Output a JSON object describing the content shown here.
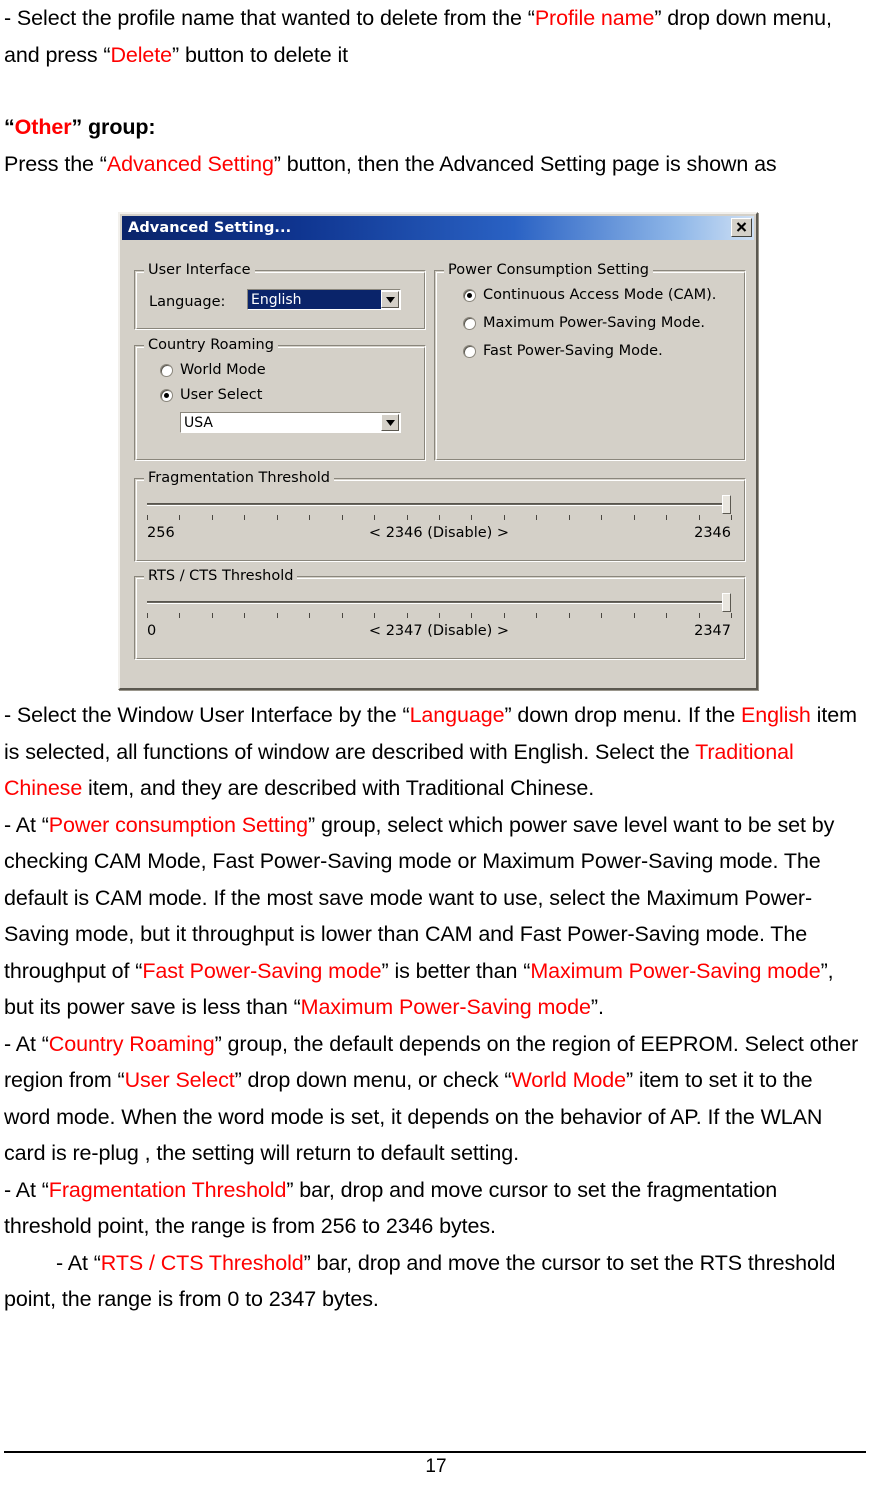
{
  "document": {
    "page_number": "17",
    "paragraphs": [
      {
        "id": "p1",
        "runs": [
          {
            "t": "-    Select the profile name that wanted to delete from the “",
            "c": "black"
          },
          {
            "t": "Profile name",
            "c": "red"
          },
          {
            "t": "” drop down menu, and press “",
            "c": "black"
          },
          {
            "t": "Delete",
            "c": "red"
          },
          {
            "t": "” button to delete it",
            "c": "black"
          }
        ]
      },
      {
        "id": "p2",
        "bold": true,
        "runs": [
          {
            "t": "“",
            "c": "black"
          },
          {
            "t": "Other",
            "c": "red"
          },
          {
            "t": "” group:",
            "c": "black"
          }
        ]
      },
      {
        "id": "p3",
        "runs": [
          {
            "t": "Press the “",
            "c": "black"
          },
          {
            "t": "Advanced Setting",
            "c": "red"
          },
          {
            "t": "” button, then the Advanced Setting page is shown as",
            "c": "black"
          }
        ]
      },
      {
        "id": "p4",
        "runs": [
          {
            "t": "-   Select the Window User Interface by the “",
            "c": "black"
          },
          {
            "t": "Language",
            "c": "red"
          },
          {
            "t": "” down drop menu. If the ",
            "c": "black"
          },
          {
            "t": "English",
            "c": "red"
          },
          {
            "t": " item is selected, all functions of window are described with English. Select the ",
            "c": "black"
          },
          {
            "t": "Traditional Chinese",
            "c": "red"
          },
          {
            "t": " item, and they are described with Traditional Chinese.",
            "c": "black"
          }
        ]
      },
      {
        "id": "p5",
        "runs": [
          {
            "t": "-   At “",
            "c": "black"
          },
          {
            "t": "Power consumption Setting",
            "c": "red"
          },
          {
            "t": "” group, select which power save level want to be set by checking CAM Mode, Fast Power-Saving mode or Maximum Power-Saving mode. The default is CAM mode. If the most save mode want to use, select the Maximum Power-Saving mode, but it throughput is lower than CAM and Fast Power-Saving mode. The throughput of   “",
            "c": "black"
          },
          {
            "t": "Fast Power-Saving mode",
            "c": "red"
          },
          {
            "t": "” is better than “",
            "c": "black"
          },
          {
            "t": "Maximum Power-Saving mode",
            "c": "red"
          },
          {
            "t": "”, but its power save is less than “",
            "c": "black"
          },
          {
            "t": "Maximum Power-Saving mode",
            "c": "red"
          },
          {
            "t": "”.",
            "c": "black"
          }
        ]
      },
      {
        "id": "p6",
        "runs": [
          {
            "t": "-   At “",
            "c": "black"
          },
          {
            "t": "Country Roaming",
            "c": "red"
          },
          {
            "t": "” group, the default depends on the region of EEPROM. Select other region from “",
            "c": "black"
          },
          {
            "t": "User Select",
            "c": "red"
          },
          {
            "t": "” drop down menu, or check “",
            "c": "black"
          },
          {
            "t": "World Mode",
            "c": "red"
          },
          {
            "t": "” item to set it to the word mode. When the word mode is set, it depends on the behavior of AP. If the WLAN card is re-plug , the setting will return to default setting.",
            "c": "black"
          }
        ]
      },
      {
        "id": "p7",
        "runs": [
          {
            "t": "-   At “",
            "c": "black"
          },
          {
            "t": "Fragmentation Threshold",
            "c": "red"
          },
          {
            "t": "” bar, drop and move cursor to set the fragmentation threshold point, the range is from 256 to 2346 bytes.",
            "c": "black"
          }
        ]
      },
      {
        "id": "p8",
        "indent": true,
        "runs": [
          {
            "t": "-   At “",
            "c": "black"
          },
          {
            "t": "RTS / CTS Threshold",
            "c": "red"
          },
          {
            "t": "” bar, drop and move the cursor to set the RTS threshold point, the range is from 0 to 2347 bytes.",
            "c": "black"
          }
        ]
      }
    ]
  },
  "dialog": {
    "title": "Advanced Setting...",
    "close_label": "×",
    "user_interface": {
      "legend": "User Interface",
      "language_label": "Language:",
      "language_value": "English"
    },
    "country_roaming": {
      "legend": "Country Roaming",
      "options": [
        {
          "label": "World Mode",
          "checked": false
        },
        {
          "label": "User Select",
          "checked": true
        }
      ],
      "region_value": "USA"
    },
    "power_consumption": {
      "legend": "Power Consumption Setting",
      "options": [
        {
          "label": "Continuous Access Mode (CAM).",
          "checked": true
        },
        {
          "label": "Maximum Power-Saving Mode.",
          "checked": false
        },
        {
          "label": "Fast Power-Saving Mode.",
          "checked": false
        }
      ]
    },
    "fragmentation": {
      "legend": "Fragmentation Threshold",
      "min_label": "256",
      "max_label": "2346",
      "current_label": "< 2346 (Disable) >",
      "position_pct": 100,
      "tick_count": 19
    },
    "rts_cts": {
      "legend": "RTS / CTS Threshold",
      "min_label": "0",
      "max_label": "2347",
      "current_label": "< 2347 (Disable) >",
      "position_pct": 100,
      "tick_count": 19
    }
  }
}
